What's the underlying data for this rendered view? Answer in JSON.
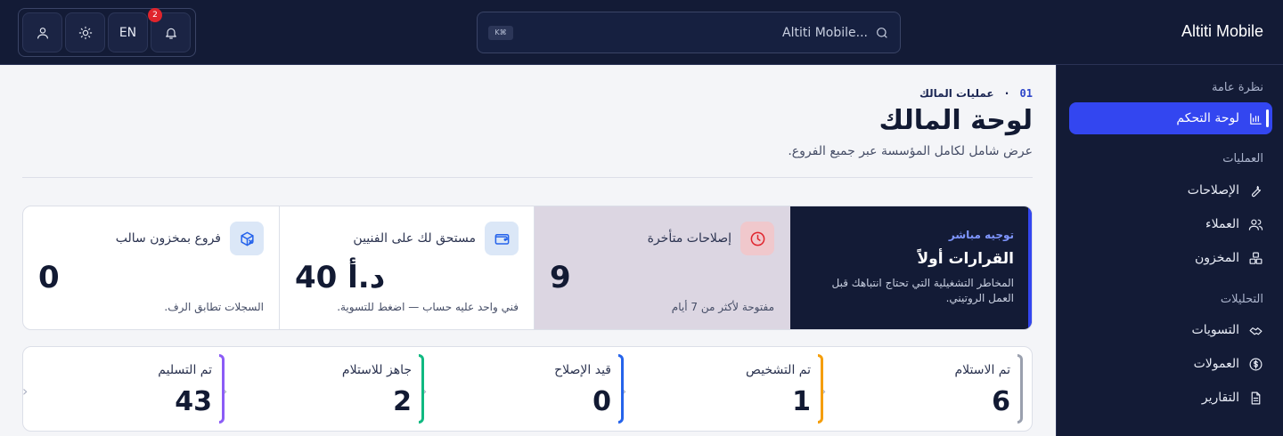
{
  "topbar": {
    "brand": "Altiti Mobile",
    "search_placeholder": "...Altiti Mobile",
    "search_shortcut": "K⌘",
    "lang_label": "EN",
    "notification_count": "2"
  },
  "sidebar": {
    "sections": [
      {
        "title": "نظرة عامة",
        "items": [
          {
            "label": "لوحة التحكم",
            "icon": "chart-bar-icon",
            "active": true
          }
        ]
      },
      {
        "title": "العمليات",
        "items": [
          {
            "label": "الإصلاحات",
            "icon": "wrench-icon"
          },
          {
            "label": "العملاء",
            "icon": "users-icon"
          },
          {
            "label": "المخزون",
            "icon": "boxes-icon"
          }
        ]
      },
      {
        "title": "التحليلات",
        "items": [
          {
            "label": "التسويات",
            "icon": "handshake-icon"
          },
          {
            "label": "العمولات",
            "icon": "coin-icon"
          },
          {
            "label": "التقارير",
            "icon": "file-icon"
          }
        ]
      }
    ]
  },
  "page": {
    "crumb_num": "01",
    "crumb_sep": "·",
    "crumb_label": "عمليات المالك",
    "title": "لوحة المالك",
    "subtitle": "عرض شامل لكامل المؤسسة عبر جميع الفروع."
  },
  "feature": {
    "tag": "توجيه مباشر",
    "title": "القرارات أولاً",
    "desc": "المخاطر التشغيلية التي تحتاج انتباهك قبل العمل الروتيني."
  },
  "stats": [
    {
      "label": "إصلاحات متأخرة",
      "value": "9",
      "note": "مفتوحة لأكثر من 7 أيام",
      "icon": "clock-icon",
      "accent": "#e0242c"
    },
    {
      "label": "مستحق لك على الفنيين",
      "value": "40 د.أ",
      "note": "فني واحد عليه حساب — اضغط للتسوية.",
      "icon": "wallet-icon",
      "accent": "#2563eb"
    },
    {
      "label": "فروع بمخزون سالب",
      "value": "0",
      "note": "السجلات تطابق الرف.",
      "icon": "package-x-icon",
      "accent": "#2563eb"
    }
  ],
  "pipeline": [
    {
      "label": "تم الاستلام",
      "value": "6",
      "color": "#9aa0ae"
    },
    {
      "label": "تم التشخيص",
      "value": "1",
      "color": "#f59e0b"
    },
    {
      "label": "قيد الإصلاح",
      "value": "0",
      "color": "#2563eb"
    },
    {
      "label": "جاهز للاستلام",
      "value": "2",
      "color": "#10b981"
    },
    {
      "label": "تم التسليم",
      "value": "43",
      "color": "#8b5cf6"
    }
  ],
  "pipeline_chevron": "›"
}
